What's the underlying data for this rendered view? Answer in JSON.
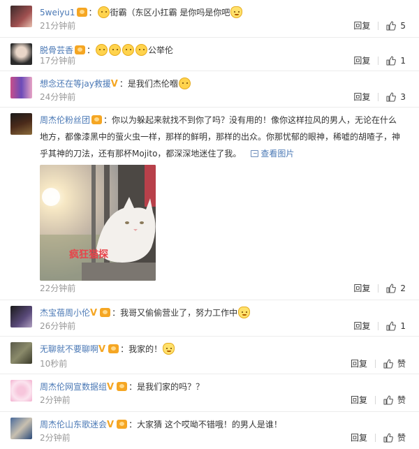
{
  "comments": [
    {
      "user": "5weiyu1",
      "sep": "：",
      "body": "街霸（东区小扛霸 是你吗是你吧",
      "time": "21分钟前",
      "reply": "回复",
      "likes": "5"
    },
    {
      "user": "脱骨芸香",
      "sep": "：",
      "body": "公举伦",
      "time": "17分钟前",
      "reply": "回复",
      "likes": "1"
    },
    {
      "user": "想念还在等jay救援",
      "sep": "：",
      "body": "是我们杰伦嗰",
      "time": "24分钟前",
      "reply": "回复",
      "likes": "3"
    },
    {
      "user": "周杰伦粉丝团",
      "sep": "：",
      "body1": "你以为躲起来就找不到你了吗？没有用的！像你这样拉风的男人，无论在什么",
      "body2": "地方，都像漆黑中的萤火虫一样，那样的鲜明，那样的出众。你那忧郁的眼神，稀嘘的胡喳子，神",
      "body3": "乎其神的刀法，还有那杯Mojito，都深深地迷住了我。",
      "view_image": "查看图片",
      "watermark": "疯狂猫探",
      "time": "22分钟前",
      "reply": "回复",
      "likes": "2"
    },
    {
      "user": "杰宝蓓周小伦",
      "sep": "：",
      "body": "我哥又偷偷营业了，努力工作中",
      "time": "26分钟前",
      "reply": "回复",
      "likes": "1"
    },
    {
      "user": "无聊就不要聊啊",
      "sep": "：",
      "body": "我家的！",
      "time": "10秒前",
      "reply": "回复",
      "likes": "赞"
    },
    {
      "user": "周杰伦网宣数据组",
      "sep": "：",
      "body": "是我们家的吗？？",
      "time": "2分钟前",
      "reply": "回复",
      "likes": "赞"
    },
    {
      "user": "周杰伦山东歌迷会",
      "sep": "：",
      "body": "大家猜 这个哎呦不错哦！的男人是谁！",
      "time": "2分钟前",
      "reply": "回复",
      "likes": "赞"
    }
  ],
  "icons": {
    "thumb": "thumbs-up-icon",
    "link": "image-link-icon",
    "vip": "verified-v-icon",
    "badge": "member-badge-icon"
  },
  "colors": {
    "username": "#4a78b5",
    "meta": "#999999",
    "divider": "#ececec"
  }
}
